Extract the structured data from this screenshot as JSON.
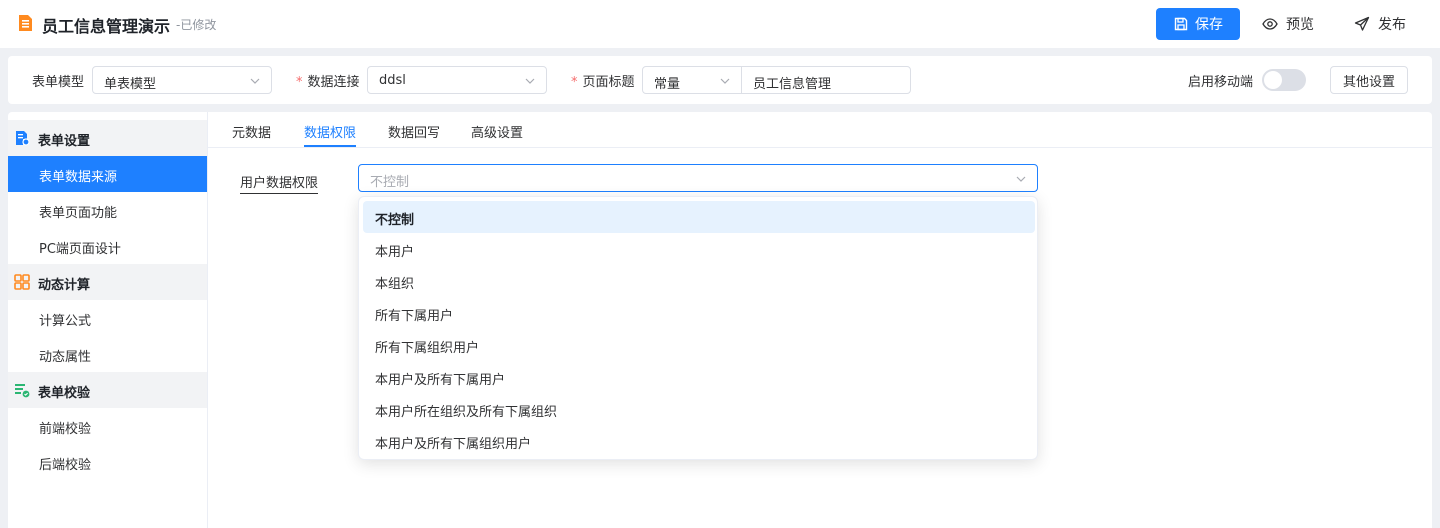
{
  "header": {
    "app_title": "员工信息管理演示",
    "status": "-已修改",
    "save_label": "保存",
    "preview_label": "预览",
    "publish_label": "发布",
    "accent_color": "#1e80ff"
  },
  "config": {
    "form_model_label": "表单模型",
    "form_model_value": "单表模型",
    "data_conn_label": "数据连接",
    "data_conn_value": "ddsl",
    "page_title_label": "页面标题",
    "page_title_type": "常量",
    "page_title_value": "员工信息管理",
    "mobile_label": "启用移动端",
    "mobile_enabled": false,
    "other_settings_label": "其他设置"
  },
  "sidebar": {
    "groups": [
      {
        "label": "表单设置",
        "icon": "form-settings-icon",
        "items": [
          {
            "label": "表单数据来源",
            "active": true
          },
          {
            "label": "表单页面功能",
            "active": false
          },
          {
            "label": "PC端页面设计",
            "active": false
          }
        ]
      },
      {
        "label": "动态计算",
        "icon": "grid-calc-icon",
        "items": [
          {
            "label": "计算公式",
            "active": false
          },
          {
            "label": "动态属性",
            "active": false
          }
        ]
      },
      {
        "label": "表单校验",
        "icon": "form-validate-icon",
        "items": [
          {
            "label": "前端校验",
            "active": false
          },
          {
            "label": "后端校验",
            "active": false
          }
        ]
      }
    ]
  },
  "main": {
    "tabs": [
      {
        "label": "元数据",
        "active": false
      },
      {
        "label": "数据权限",
        "active": true
      },
      {
        "label": "数据回写",
        "active": false
      },
      {
        "label": "高级设置",
        "active": false
      }
    ],
    "field_label": "用户数据权限",
    "select_placeholder": "不控制"
  },
  "dropdown": {
    "options": [
      {
        "label": "不控制",
        "selected": true
      },
      {
        "label": "本用户",
        "selected": false
      },
      {
        "label": "本组织",
        "selected": false
      },
      {
        "label": "所有下属用户",
        "selected": false
      },
      {
        "label": "所有下属组织用户",
        "selected": false
      },
      {
        "label": "本用户及所有下属用户",
        "selected": false
      },
      {
        "label": "本用户所在组织及所有下属组织",
        "selected": false
      },
      {
        "label": "本用户及所有下属组织用户",
        "selected": false
      }
    ]
  }
}
